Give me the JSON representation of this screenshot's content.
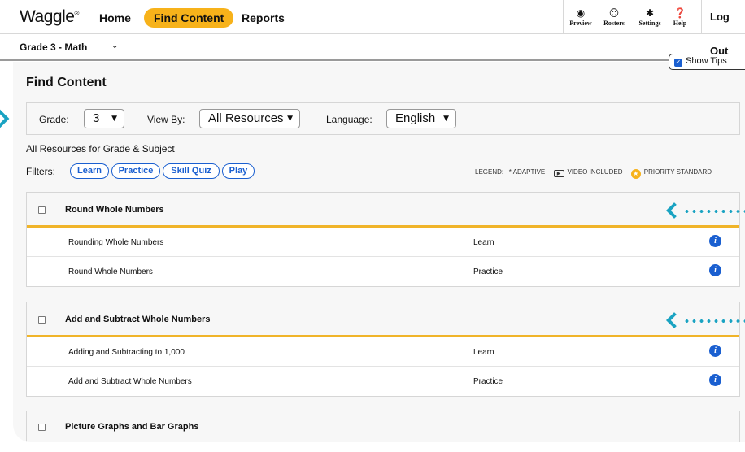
{
  "header": {
    "logo": "Waggle",
    "logo_mark": "®",
    "nav": {
      "home": "Home",
      "find_content": "Find Content",
      "reports": "Reports"
    },
    "tools": [
      {
        "label": "Preview",
        "icon": "eye-icon"
      },
      {
        "label": "Rosters",
        "icon": "face-icon"
      },
      {
        "label": "Settings",
        "icon": "gear-icon"
      },
      {
        "label": "Help",
        "icon": "help-icon"
      }
    ],
    "logout": "Log Out"
  },
  "subject": {
    "label": "Grade 3 - Math"
  },
  "tips": {
    "label": "Show Tips",
    "checked": true
  },
  "page": {
    "title": "Find Content",
    "filters": {
      "grade_label": "Grade:",
      "grade_value": "3",
      "view_label": "View By:",
      "view_value": "All Resources",
      "language_label": "Language:",
      "language_value": "English"
    },
    "results_label": "All Resources for Grade & Subject",
    "filters_label": "Filters:",
    "pills": [
      "Learn",
      "Practice",
      "Skill Quiz",
      "Play"
    ],
    "legend": {
      "label": "LEGEND:",
      "adaptive": "* ADAPTIVE",
      "video": "VIDEO INCLUDED",
      "priority": "PRIORITY STANDARD"
    }
  },
  "groups": [
    {
      "title": "Round Whole Numbers",
      "rows": [
        {
          "name": "Rounding Whole Numbers",
          "type": "Learn"
        },
        {
          "name": "Round Whole Numbers",
          "type": "Practice"
        }
      ]
    },
    {
      "title": "Add and Subtract Whole Numbers",
      "rows": [
        {
          "name": "Adding and Subtracting to 1,000",
          "type": "Learn"
        },
        {
          "name": "Add and Subtract Whole Numbers",
          "type": "Practice"
        }
      ]
    },
    {
      "title": "Picture Graphs and Bar Graphs"
    }
  ],
  "colors": {
    "accent": "#f7b21a",
    "link": "#1a5fd0",
    "tour": "#1aa3c2",
    "divider": "#f0b429"
  }
}
